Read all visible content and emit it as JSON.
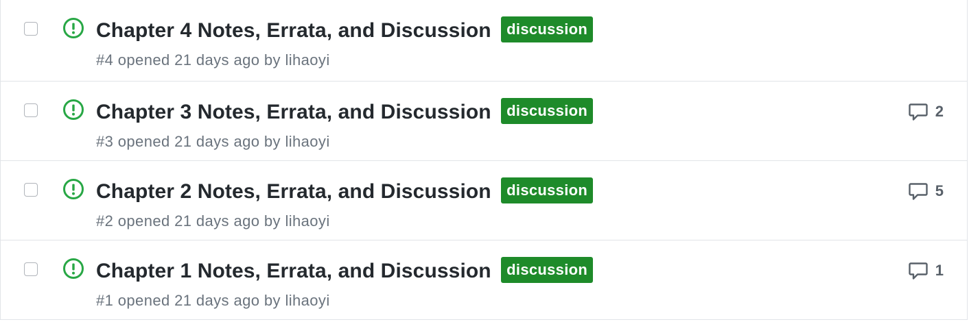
{
  "colors": {
    "open_icon": "#28a745",
    "label_discussion": "#1e8b2a",
    "title_text": "#24292e",
    "meta_text": "#6a737d",
    "border": "#e1e4e8"
  },
  "issues": [
    {
      "title": "Chapter 4 Notes, Errata, and Discussion",
      "label": "discussion",
      "meta": "#4 opened 21 days ago by lihaoyi",
      "comments": null,
      "state_icon": "issue-opened-icon"
    },
    {
      "title": "Chapter 3 Notes, Errata, and Discussion",
      "label": "discussion",
      "meta": "#3 opened 21 days ago by lihaoyi",
      "comments": "2",
      "state_icon": "issue-opened-icon"
    },
    {
      "title": "Chapter 2 Notes, Errata, and Discussion",
      "label": "discussion",
      "meta": "#2 opened 21 days ago by lihaoyi",
      "comments": "5",
      "state_icon": "issue-opened-icon"
    },
    {
      "title": "Chapter 1 Notes, Errata, and Discussion",
      "label": "discussion",
      "meta": "#1 opened 21 days ago by lihaoyi",
      "comments": "1",
      "state_icon": "issue-opened-icon"
    }
  ]
}
